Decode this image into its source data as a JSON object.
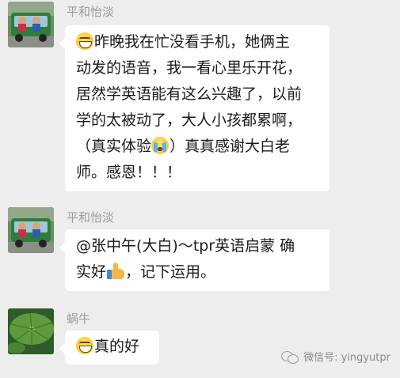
{
  "messages": [
    {
      "sender": "平和怡淡",
      "avatar": "kids-in-car-photo",
      "emoji_lead": "grin-emoji",
      "lines": [
        "昨晚我在忙没看手机，她俩主",
        "动发的语音，我一看心里乐开花，",
        "居然学英语能有这么兴趣了，以前",
        "学的太被动了，大人小孩都累啊，",
        "（真实体验",
        "）真真感谢大白老",
        "师。感恩！！！"
      ]
    },
    {
      "sender": "平和怡淡",
      "avatar": "kids-in-car-photo",
      "lines": [
        "@张中午(大白)～tpr英语启蒙  确",
        "实好",
        "，记下运用。"
      ]
    },
    {
      "sender": "蜗牛",
      "avatar": "lotus-leaf-photo",
      "emoji_lead": "grin-emoji",
      "lines": [
        "真的好"
      ]
    }
  ],
  "watermark": {
    "icon": "wechat-icon",
    "text": "微信号: yingyutpr"
  },
  "colors": {
    "background": "#ededed",
    "bubble": "#ffffff",
    "sender_name": "#9b9b9b"
  }
}
